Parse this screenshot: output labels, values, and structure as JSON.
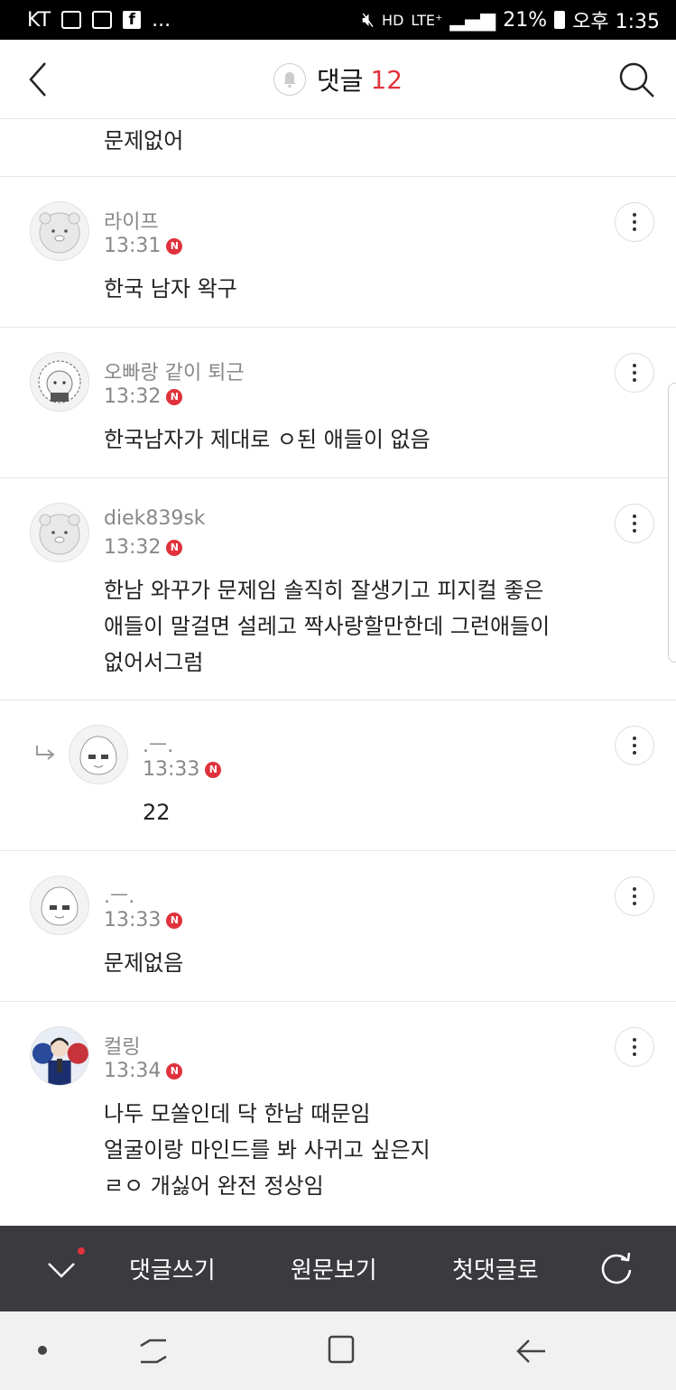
{
  "status_bar": {
    "carrier": "KT",
    "extra": "...",
    "network": "LTE⁺",
    "battery": "21%",
    "time": "오후 1:35"
  },
  "header": {
    "title": "댓글",
    "count": "12",
    "icons": [
      "back-icon",
      "bell-icon",
      "search-icon"
    ]
  },
  "partial_comment": {
    "text": "문제없어"
  },
  "comments": [
    {
      "name": "라이프",
      "time": "13:31",
      "text": "한국 남자 왁구",
      "reply": false
    },
    {
      "name": "오빠랑 같이 퇴근",
      "time": "13:32",
      "text": "한국남자가 제대로 ㅇ된 애들이 없음",
      "reply": false
    },
    {
      "name": "diek839sk",
      "time": "13:32",
      "text": "한남 와꾸가 문제임 솔직히 잘생기고 피지컬 좋은\n애들이 말걸면 설레고 짝사랑할만한데 그런애들이\n없어서그럼",
      "reply": false
    },
    {
      "name": ".ㅡ.",
      "time": "13:33",
      "text": "22",
      "reply": true
    },
    {
      "name": ".ㅡ.",
      "time": "13:33",
      "text": "문제없음",
      "reply": false
    },
    {
      "name": "컬링",
      "time": "13:34",
      "text": "나두 모쏠인데 닥 한남 때문임\n얼굴이랑 마인드를 봐 사귀고 싶은지\nㄹㅇ 개싫어 완전 정상임",
      "reply": false
    }
  ],
  "new_badge": "N",
  "toolbar": {
    "write": "댓글쓰기",
    "original": "원문보기",
    "first": "첫댓글로"
  },
  "colors": {
    "accent": "#e0323c",
    "toolbar_bg": "#3a3a3f",
    "meta_text": "#888888"
  }
}
